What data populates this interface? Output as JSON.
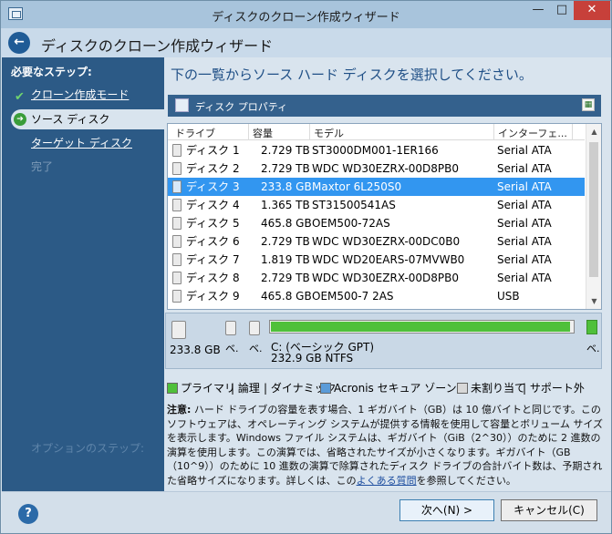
{
  "window": {
    "title": "ディスクのクローン作成ウィザード",
    "buttons": {
      "minimize": "—",
      "maximize": "□",
      "close": "✕"
    }
  },
  "header": {
    "back_icon": "←",
    "title": "ディスクのクローン作成ウィザード"
  },
  "sidebar": {
    "heading": "必要なステップ:",
    "items": [
      {
        "label": "クローン作成モード",
        "state": "done"
      },
      {
        "label": "ソース ディスク",
        "state": "current"
      },
      {
        "label": "ターゲット ディスク",
        "state": "link"
      },
      {
        "label": "完了",
        "state": "disabled"
      }
    ],
    "optional_heading": "オプションのステップ:"
  },
  "main": {
    "heading": "下の一覧からソース ハード ディスクを選択してください。",
    "properties_label": "ディスク プロパティ"
  },
  "table": {
    "columns": [
      "ドライブ",
      "容量",
      "モデル",
      "インターフェ..."
    ],
    "rows": [
      {
        "drive": "ディスク 1",
        "capacity": "2.729 TB",
        "model": "ST3000DM001-1ER166",
        "interface": "Serial ATA",
        "selected": false
      },
      {
        "drive": "ディスク 2",
        "capacity": "2.729 TB",
        "model": "WDC WD30EZRX-00D8PB0",
        "interface": "Serial ATA",
        "selected": false
      },
      {
        "drive": "ディスク 3",
        "capacity": "233.8 GB",
        "model": "Maxtor 6L250S0",
        "interface": "Serial ATA",
        "selected": true
      },
      {
        "drive": "ディスク 4",
        "capacity": "1.365 TB",
        "model": "ST31500541AS",
        "interface": "Serial ATA",
        "selected": false
      },
      {
        "drive": "ディスク 5",
        "capacity": "465.8 GB",
        "model": "OEM500-72AS",
        "interface": "Serial ATA",
        "selected": false
      },
      {
        "drive": "ディスク 6",
        "capacity": "2.729 TB",
        "model": "WDC WD30EZRX-00DC0B0",
        "interface": "Serial ATA",
        "selected": false
      },
      {
        "drive": "ディスク 7",
        "capacity": "1.819 TB",
        "model": "WDC WD20EARS-07MVWB0",
        "interface": "Serial ATA",
        "selected": false
      },
      {
        "drive": "ディスク 8",
        "capacity": "2.729 TB",
        "model": "WDC WD30EZRX-00D8PB0",
        "interface": "Serial ATA",
        "selected": false
      },
      {
        "drive": "ディスク 9",
        "capacity": "465.8 GB",
        "model": "OEM500-7 2AS",
        "interface": "USB",
        "selected": false
      }
    ]
  },
  "partition_map": {
    "disk_size": "233.8 GB",
    "truncated_label": "ベ.",
    "partition_name": "C: (ベーシック GPT)",
    "partition_fs": "232.9 GB  NTFS",
    "fill_fraction": 0.99
  },
  "legend": {
    "primary": "プライマリ",
    "logical": "論理",
    "dynamic": "ダイナミック",
    "acronis": "Acronis セキュア ゾーン",
    "unallocated": "未割り当て",
    "unsupported": "サポート外",
    "colors": {
      "primary": "#4fc03a",
      "logical": "#5a9bd8",
      "dynamic": "#b28ad6",
      "acronis": "#e0a93a",
      "unallocated": "#d8d8d8",
      "unsupported": "#ffffff"
    }
  },
  "note": {
    "label": "注意:",
    "text": " ハード ドライブの容量を表す場合、1 ギガバイト（GB）は 10 億バイトと同じです。このソフトウェアは、オペレーティング システムが提供する情報を使用して容量とボリューム サイズを表示します。Windows ファイル システムは、ギガバイト（GiB（2^30））のために 2 進数の演算を使用します。この演算では、省略されたサイズが小さくなります。ギガバイト（GB（10^9））のために 10 進数の演算で除算されたディスク ドライブの合計バイト数は、予期された省略サイズになります。詳しくは、この",
    "link": "よくある質問",
    "tail": "を参照してください。"
  },
  "footer": {
    "help": "?",
    "next": "次へ(N) >",
    "cancel": "キャンセル(C)"
  },
  "colors": {
    "sidebar": "#2c5a86",
    "selection": "#3296f0",
    "heading": "#1f4f86"
  }
}
